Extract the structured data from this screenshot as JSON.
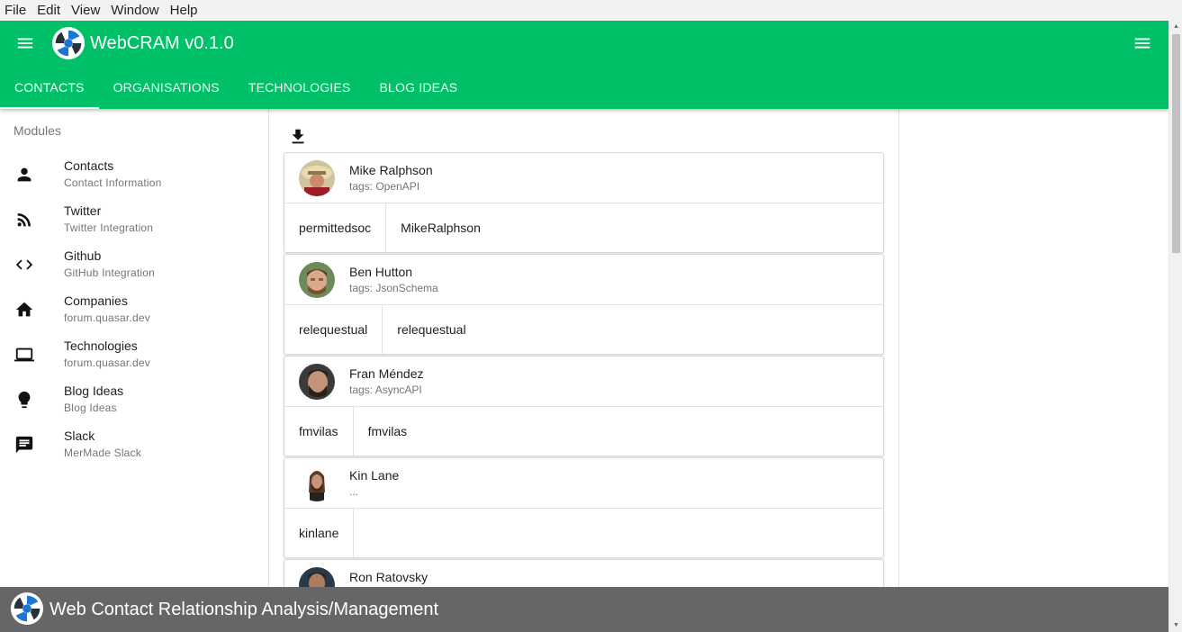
{
  "menubar": {
    "items": [
      "File",
      "Edit",
      "View",
      "Window",
      "Help"
    ]
  },
  "header": {
    "title": "WebCRAM v0.1.0",
    "color": "#00c168",
    "tabs": [
      "CONTACTS",
      "ORGANISATIONS",
      "TECHNOLOGIES",
      "BLOG IDEAS"
    ],
    "active_tab": "CONTACTS"
  },
  "sidebar": {
    "header": "Modules",
    "items": [
      {
        "label": "Contacts",
        "caption": "Contact Information",
        "icon": "person-icon"
      },
      {
        "label": "Twitter",
        "caption": "Twitter Integration",
        "icon": "rss-feed-icon"
      },
      {
        "label": "Github",
        "caption": "GitHub Integration",
        "icon": "code-icon"
      },
      {
        "label": "Companies",
        "caption": "forum.quasar.dev",
        "icon": "home-icon"
      },
      {
        "label": "Technologies",
        "caption": "forum.quasar.dev",
        "icon": "laptop-icon"
      },
      {
        "label": "Blog Ideas",
        "caption": "Blog Ideas",
        "icon": "lightbulb-icon"
      },
      {
        "label": "Slack",
        "caption": "MerMade Slack",
        "icon": "chat-icon"
      }
    ]
  },
  "contacts": [
    {
      "name": "Mike Ralphson",
      "tags": "tags: OpenAPI",
      "links": [
        "permittedsoc",
        "MikeRalphson"
      ]
    },
    {
      "name": "Ben Hutton",
      "tags": "tags: JsonSchema",
      "links": [
        "relequestual",
        "relequestual"
      ]
    },
    {
      "name": "Fran Méndez",
      "tags": "tags: AsyncAPI",
      "links": [
        "fmvilas",
        "fmvilas"
      ]
    },
    {
      "name": "Kin Lane",
      "tags": "...",
      "links": [
        "kinlane",
        ""
      ]
    },
    {
      "name": "Ron Ratovsky",
      "tags": "",
      "links": [
        "",
        ""
      ]
    }
  ],
  "footer": {
    "title": "Web Contact Relationship Analysis/Management"
  }
}
